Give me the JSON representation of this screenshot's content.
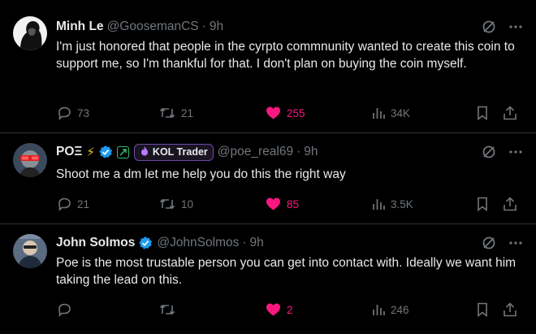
{
  "tweets": [
    {
      "name": "Minh Le",
      "handle": "@GoosemanCS",
      "dot": "·",
      "time": "9h",
      "text": "I'm just honored that people in the cyrpto commnunity wanted to create this coin to support me, so I'm thankful for that. I don't plan on buying the coin myself.",
      "replies": "73",
      "reposts": "21",
      "likes": "255",
      "views": "34K"
    },
    {
      "name": "POΞ",
      "name_emoji": "⚡",
      "badge_label": "KOL Trader",
      "handle": "@poe_real69",
      "dot": "·",
      "time": "9h",
      "text": "Shoot me a dm let me help you do this the right way",
      "replies": "21",
      "reposts": "10",
      "likes": "85",
      "views": "3.5K"
    },
    {
      "name": "John Solmos",
      "handle": "@JohnSolmos",
      "dot": "·",
      "time": "9h",
      "text": "Poe is the most trustable person you can get into contact with. Ideally we want him taking the lead on this.",
      "replies": "",
      "reposts": "",
      "likes": "2",
      "views": "246"
    }
  ],
  "colors": {
    "background": "#000000",
    "text": "#e7e9ea",
    "muted": "#71767b",
    "like": "#f91880",
    "verified": "#1d9bf0",
    "divider": "#2f3336"
  },
  "icons": [
    "grok-icon",
    "more-icon",
    "reply-icon",
    "repost-icon",
    "like-icon",
    "views-icon",
    "bookmark-icon",
    "share-icon",
    "verified-icon"
  ]
}
